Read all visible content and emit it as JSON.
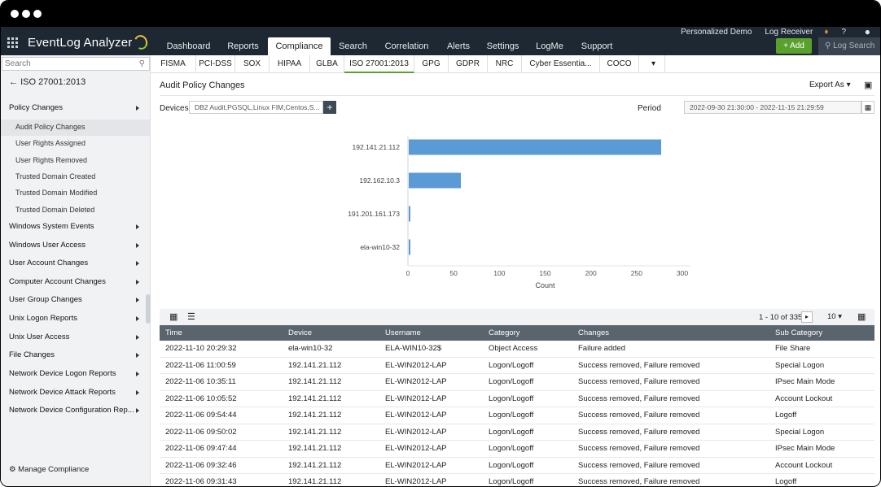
{
  "app": {
    "title": "EventLog Analyzer"
  },
  "toplinks": [
    "Personalized Demo",
    "Log Receiver",
    "?"
  ],
  "nav": {
    "tabs": [
      "Dashboard",
      "Reports",
      "Compliance",
      "Search",
      "Correlation",
      "Alerts",
      "Settings",
      "LogMe",
      "Support"
    ],
    "active": "Compliance",
    "add_label": "+ Add",
    "search_label": "Log Search"
  },
  "subtabs": {
    "items": [
      "FISMA",
      "PCI-DSS",
      "SOX",
      "HIPAA",
      "GLBA",
      "ISO 27001:2013",
      "GPG",
      "GDPR",
      "NRC",
      "Cyber Essentia...",
      "COCO"
    ],
    "active": "ISO 27001:2013"
  },
  "sidebar": {
    "search_placeholder": "Search",
    "title": "ISO 27001:2013",
    "categories": [
      "Policy Changes",
      "Windows System Events",
      "Windows User Access",
      "User Account Changes",
      "Computer Account Changes",
      "User Group Changes",
      "Unix Logon Reports",
      "Unix User Access",
      "File Changes",
      "Network Device Logon Reports",
      "Network Device Attack Reports",
      "Network Device Configuration Rep..."
    ],
    "subitems": [
      "Audit Policy Changes",
      "User Rights Assigned",
      "User Rights Removed",
      "Trusted Domain Created",
      "Trusted Domain Modified",
      "Trusted Domain Deleted"
    ],
    "selected": "Audit Policy Changes",
    "manage_label": "Manage Compliance"
  },
  "main": {
    "title": "Audit Policy Changes",
    "export_label": "Export As",
    "devices_label": "Devices",
    "devices_value": "DB2 Audit,PGSQL,Linux FIM,Centos,S...",
    "period_label": "Period",
    "period_value": "2022-09-30 21:30:00 - 2022-11-15 21:29:59"
  },
  "chart_data": {
    "type": "bar",
    "orientation": "horizontal",
    "categories": [
      "192.141.21.112",
      "192.162.10.3",
      "191.201.161.173",
      "ela-win10-32"
    ],
    "values": [
      276,
      57,
      1,
      1
    ],
    "xlabel": "Count",
    "ylabel": "",
    "xlim": [
      0,
      300
    ],
    "xticks": [
      0,
      50,
      100,
      150,
      200,
      250,
      300
    ],
    "bar_color": "#5b9bd5",
    "grid": false
  },
  "table": {
    "pager": "1 - 10 of 335",
    "page_size": "10",
    "columns": [
      "Time",
      "Device",
      "Username",
      "Category",
      "Changes",
      "Sub Category"
    ],
    "rows": [
      [
        "2022-11-10 20:29:32",
        "ela-win10-32",
        "ELA-WIN10-32$",
        "Object Access",
        "Failure added",
        "File Share"
      ],
      [
        "2022-11-06 11:00:59",
        "192.141.21.112",
        "EL-WIN2012-LAP",
        "Logon/Logoff",
        "Success removed, Failure removed",
        "Special Logon"
      ],
      [
        "2022-11-06 10:35:11",
        "192.141.21.112",
        "EL-WIN2012-LAP",
        "Logon/Logoff",
        "Success removed, Failure removed",
        "IPsec Main Mode"
      ],
      [
        "2022-11-06 10:05:52",
        "192.141.21.112",
        "EL-WIN2012-LAP",
        "Logon/Logoff",
        "Success removed, Failure removed",
        "Account Lockout"
      ],
      [
        "2022-11-06 09:54:44",
        "192.141.21.112",
        "EL-WIN2012-LAP",
        "Logon/Logoff",
        "Success removed, Failure removed",
        "Logoff"
      ],
      [
        "2022-11-06 09:50:02",
        "192.141.21.112",
        "EL-WIN2012-LAP",
        "Logon/Logoff",
        "Success removed, Failure removed",
        "Special Logon"
      ],
      [
        "2022-11-06 09:47:44",
        "192.141.21.112",
        "EL-WIN2012-LAP",
        "Logon/Logoff",
        "Success removed, Failure removed",
        "IPsec Main Mode"
      ],
      [
        "2022-11-06 09:32:46",
        "192.141.21.112",
        "EL-WIN2012-LAP",
        "Logon/Logoff",
        "Success removed, Failure removed",
        "Account Lockout"
      ],
      [
        "2022-11-06 09:31:43",
        "192.141.21.112",
        "EL-WIN2012-LAP",
        "Logon/Logoff",
        "Success removed, Failure removed",
        "Logoff"
      ]
    ]
  }
}
